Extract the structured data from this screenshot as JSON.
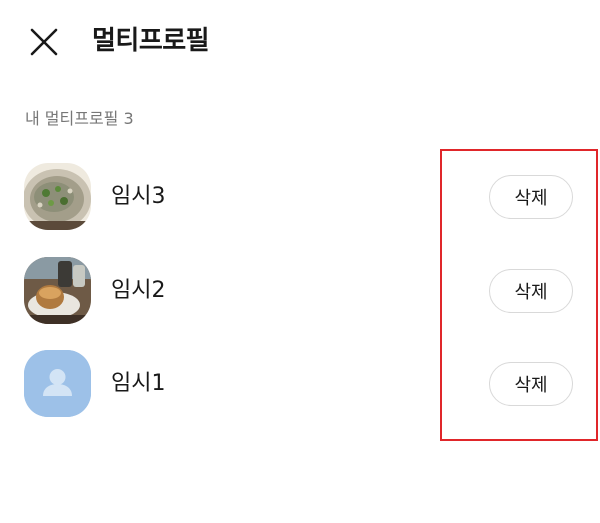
{
  "header": {
    "title": "멀티프로필",
    "close_icon": "close-icon"
  },
  "section": {
    "label": "내 멀티프로필 3"
  },
  "profiles": [
    {
      "name": "임시3",
      "avatar": "photo-noodle-soup",
      "delete_label": "삭제"
    },
    {
      "name": "임시2",
      "avatar": "photo-cafe-dessert",
      "delete_label": "삭제"
    },
    {
      "name": "임시1",
      "avatar": "default-person-icon",
      "delete_label": "삭제"
    }
  ],
  "colors": {
    "highlight": "#e0262a",
    "default_avatar_bg": "#9dc1e8",
    "section_label": "#777777"
  }
}
